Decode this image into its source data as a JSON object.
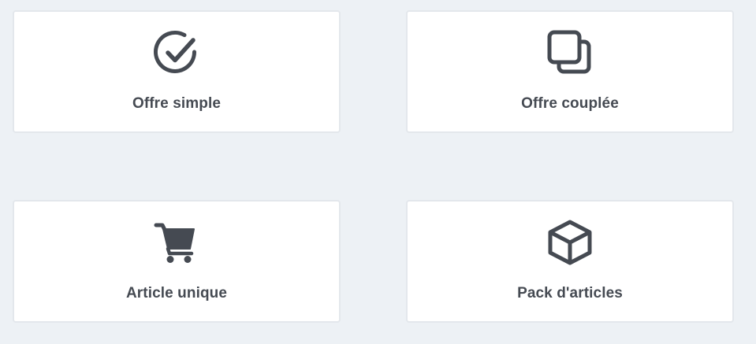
{
  "colors": {
    "background": "#edf1f5",
    "card_background": "#ffffff",
    "card_border": "#e3e7ec",
    "icon_and_text": "#454a52"
  },
  "options": [
    {
      "label": "Offre simple",
      "icon": "check-circle-icon"
    },
    {
      "label": "Offre couplée",
      "icon": "copy-squares-icon"
    },
    {
      "label": "Article unique",
      "icon": "shopping-cart-icon"
    },
    {
      "label": "Pack d'articles",
      "icon": "box-icon"
    }
  ]
}
